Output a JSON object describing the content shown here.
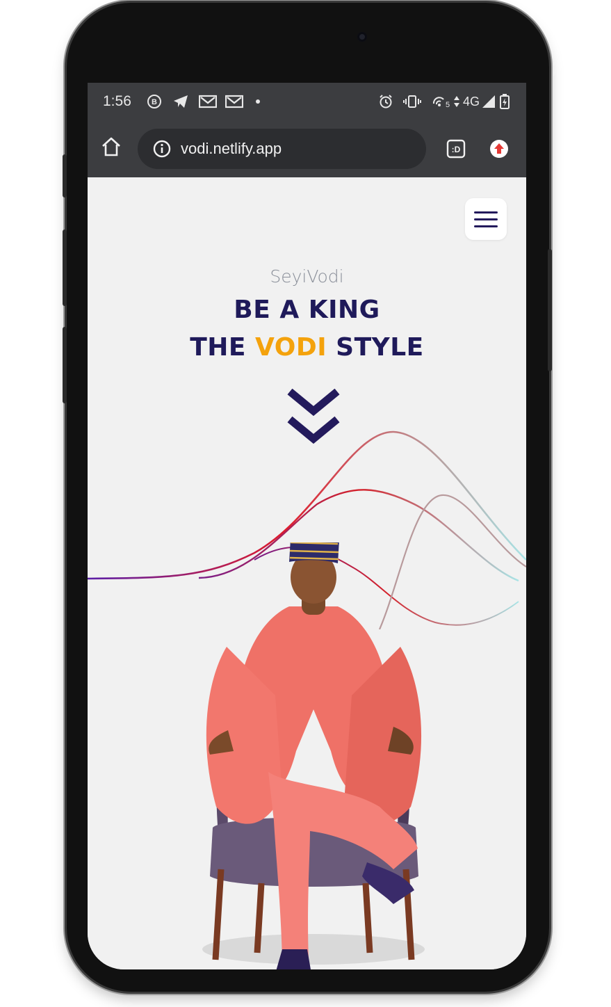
{
  "status_bar": {
    "time": "1:56",
    "network": "4G",
    "icons": [
      "business-chat-icon",
      "telegram-icon",
      "gmail-icon",
      "gmail-icon",
      "dot-icon",
      "alarm-icon",
      "vibrate-icon",
      "hotspot-icon",
      "data-arrows-icon",
      "signal-icon",
      "battery-icon"
    ]
  },
  "browser": {
    "url": "vodi.netlify.app",
    "icons": [
      "home-icon",
      "info-icon",
      "tab-switcher-icon",
      "update-icon"
    ]
  },
  "hero": {
    "brand": "SeyiVodi",
    "line1": "BE A KING",
    "line2_prefix": "THE ",
    "line2_accent": "VODI",
    "line2_suffix": " STYLE"
  },
  "colors": {
    "primary": "#1f1a5a",
    "accent": "#f4a20c",
    "brand_text": "#8a8f99",
    "page_bg": "#f1f1f1",
    "chrome_bg": "#3c3d40"
  }
}
